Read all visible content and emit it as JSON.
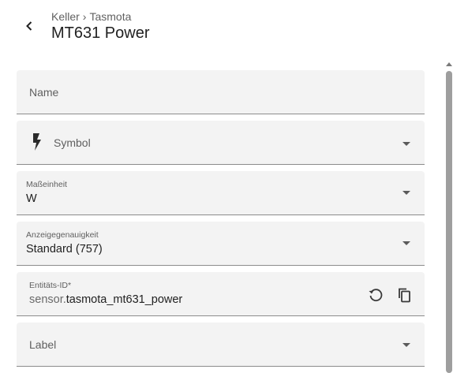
{
  "header": {
    "breadcrumb_area": "Keller",
    "breadcrumb_separator": "›",
    "breadcrumb_integration": "Tasmota",
    "title": "MT631 Power"
  },
  "form": {
    "name": {
      "placeholder": "Name"
    },
    "symbol": {
      "placeholder": "Symbol",
      "icon": "lightning-bolt-icon"
    },
    "unit": {
      "label": "Maßeinheit",
      "value": "W"
    },
    "precision": {
      "label": "Anzeigegenauigkeit",
      "value": "Standard (757)"
    },
    "entity_id": {
      "label": "Entitäts-ID*",
      "prefix": "sensor.",
      "value": "tasmota_mt631_power"
    },
    "label": {
      "placeholder": "Label"
    }
  },
  "icons": {
    "back": "back-chevron-icon",
    "restore": "restore-icon",
    "copy": "copy-icon"
  }
}
